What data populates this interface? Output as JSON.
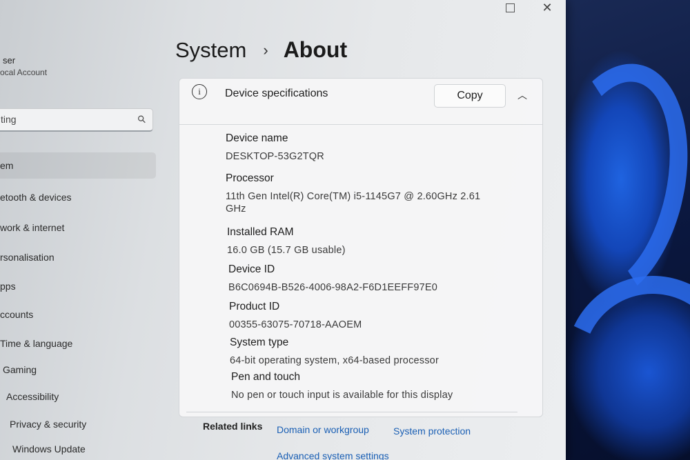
{
  "window": {
    "maximize_icon": "maximize-icon",
    "close_glyph": "✕"
  },
  "sidebar": {
    "profile_name": "ser",
    "profile_sub": "ocal Account",
    "search_value": "ting",
    "search_icon": "⚲",
    "items": [
      {
        "label": "em"
      },
      {
        "label": "etooth & devices"
      },
      {
        "label": "work & internet"
      },
      {
        "label": "rsonalisation"
      },
      {
        "label": "pps"
      },
      {
        "label": "ccounts"
      },
      {
        "label": "Time & language"
      },
      {
        "label": "Gaming"
      },
      {
        "label": "Accessibility"
      },
      {
        "label": "Privacy & security"
      },
      {
        "label": "Windows Update"
      }
    ]
  },
  "breadcrumb": {
    "parent": "System",
    "separator": "›",
    "current": "About"
  },
  "card": {
    "info_icon": "i",
    "title": "Device specifications",
    "copy_label": "Copy",
    "collapse_glyph": "︿",
    "specs": [
      {
        "label": "Device name",
        "value": "DESKTOP-53G2TQR"
      },
      {
        "label": "Processor",
        "value": "11th Gen Intel(R) Core(TM) i5-1145G7 @ 2.60GHz   2.61 GHz"
      },
      {
        "label": "Installed RAM",
        "value": "16.0 GB (15.7 GB usable)"
      },
      {
        "label": "Device ID",
        "value": "B6C0694B-B526-4006-98A2-F6D1EEFF97E0"
      },
      {
        "label": "Product ID",
        "value": "00355-63075-70718-AAOEM"
      },
      {
        "label": "System type",
        "value": "64-bit operating system, x64-based processor"
      },
      {
        "label": "Pen and touch",
        "value": "No pen or touch input is available for this display"
      }
    ]
  },
  "related": {
    "label": "Related links",
    "links": [
      "Domain or workgroup",
      "System protection",
      "Advanced system settings"
    ]
  },
  "colors": {
    "accent": "#1a5fb4",
    "wallpaper": "#1f63e0"
  }
}
